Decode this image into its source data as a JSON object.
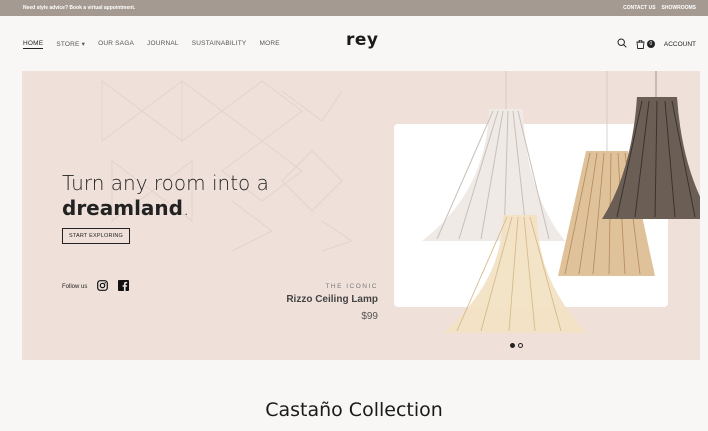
{
  "topbar": {
    "message": "Need style advice? Book a virtual appointment.",
    "links": [
      "CONTACT US",
      "SHOWROOMS"
    ]
  },
  "nav": {
    "menu": [
      "HOME",
      "STORE",
      "OUR SAGA",
      "JOURNAL",
      "SUSTAINABILITY",
      "MORE"
    ],
    "logo": "rey",
    "cart_count": "0",
    "account": "ACCOUNT"
  },
  "hero": {
    "headline_line1": "Turn any room into a",
    "headline_line2": "dreamland",
    "headline_dot": ".",
    "cta": "START EXPLORING",
    "follow_label": "Follow us",
    "product_kicker": "THE ICONIC",
    "product_name": "Rizzo Ceiling Lamp",
    "product_price": "$99",
    "slide_count": 2,
    "active_slide": 1
  },
  "section": {
    "title": "Castaño Collection"
  },
  "colors": {
    "topbar": "#a49a92",
    "hero_bg": "#efe0da",
    "text": "#222222"
  }
}
